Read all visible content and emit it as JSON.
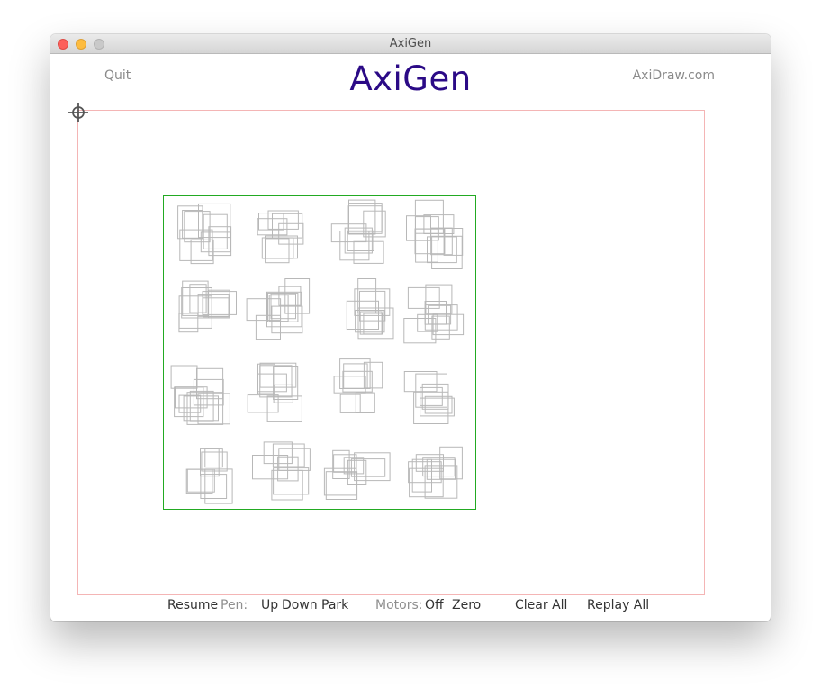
{
  "window": {
    "title": "AxiGen"
  },
  "header": {
    "quit_label": "Quit",
    "app_title": "AxiGen",
    "site_link": "AxiDraw.com"
  },
  "toolbar": {
    "resume_label": "Resume",
    "pen_label": "Pen:",
    "pen_up_label": "Up",
    "pen_down_label": "Down",
    "pen_park_label": "Park",
    "motors_label": "Motors:",
    "motors_off_label": "Off",
    "motors_zero_label": "Zero",
    "clear_all_label": "Clear All",
    "replay_all_label": "Replay All"
  },
  "colors": {
    "title": "#2b0a86",
    "bounds": "#f4b5b5",
    "artwork_frame": "#22aa22",
    "artwork_strokes": "#b8b8b8",
    "crosshair": "#555555"
  },
  "icons": {
    "home": "crosshair-icon"
  },
  "artwork": {
    "grid_rows": 4,
    "grid_cols": 4
  }
}
